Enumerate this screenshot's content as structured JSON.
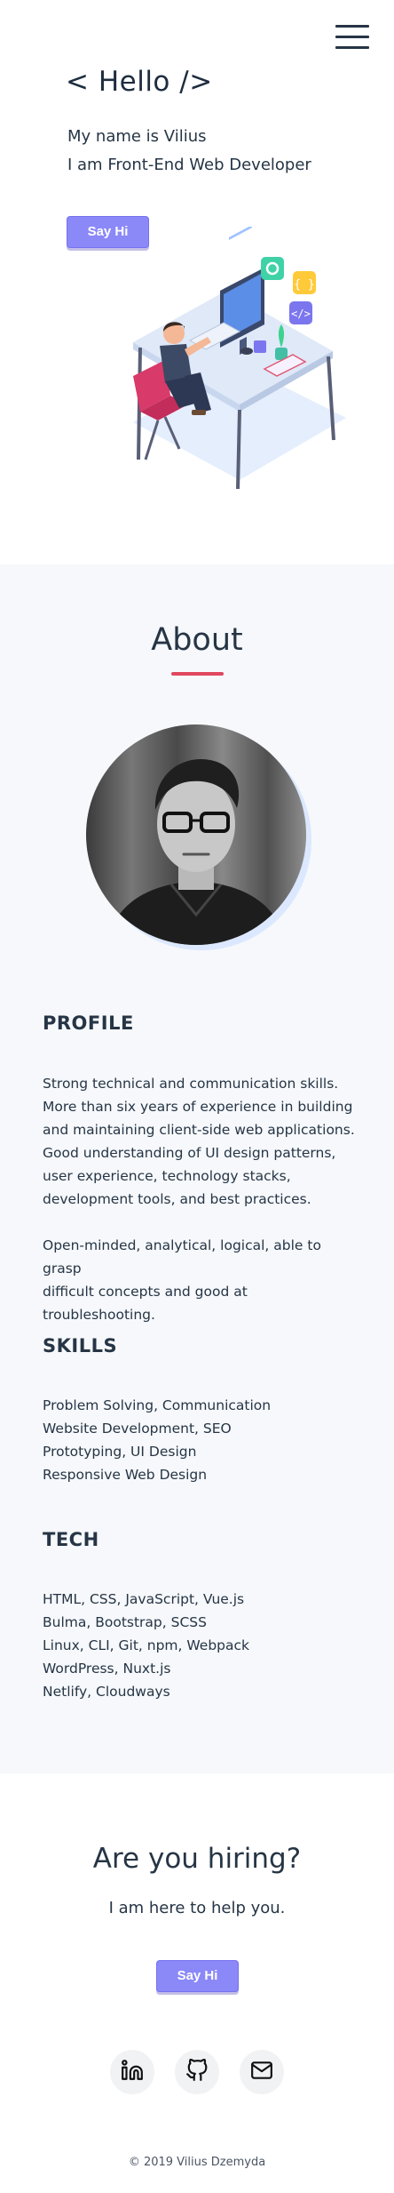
{
  "header": {
    "menu_icon": "hamburger-menu-icon"
  },
  "hero": {
    "title": "< Hello />",
    "line1": "My name is Vilius",
    "line2": "I am Front-End Web Developer",
    "button_label": "Say Hi",
    "illustration": "developer-at-desk-illustration"
  },
  "about": {
    "title": "About",
    "accent_color": "#e0475e",
    "avatar": "profile-photo",
    "profile": {
      "heading": "PROFILE",
      "paragraph1_lines": [
        "Strong technical and communication skills.",
        "More than six years of experience in building",
        "and maintaining client-side web applications.",
        "Good understanding of UI design patterns,",
        "user experience, technology stacks,",
        "development tools, and best practices."
      ],
      "paragraph2_lines": [
        "Open-minded, analytical, logical, able to grasp",
        "difficult concepts and good at troubleshooting."
      ]
    },
    "skills": {
      "heading": "SKILLS",
      "items": [
        "Problem Solving, Communication",
        "Website Development, SEO",
        "Prototyping, UI Design",
        "Responsive Web Design"
      ]
    },
    "tech": {
      "heading": "TECH",
      "items": [
        "HTML, CSS, JavaScript, Vue.js",
        "Bulma, Bootstrap, SCSS",
        "Linux, CLI, Git, npm, Webpack",
        "WordPress, Nuxt.js",
        "Netlify, Cloudways"
      ]
    }
  },
  "hiring": {
    "title": "Are you hiring?",
    "subtitle": "I am here to help you.",
    "button_label": "Say Hi"
  },
  "social": {
    "icons": [
      "linkedin-icon",
      "github-icon",
      "mail-icon"
    ]
  },
  "footer": {
    "copyright": "© 2019 Vilius Dzemyda"
  },
  "colors": {
    "button": "#8b88f8",
    "text": "#263545",
    "section_bg": "#f6f8fb"
  }
}
